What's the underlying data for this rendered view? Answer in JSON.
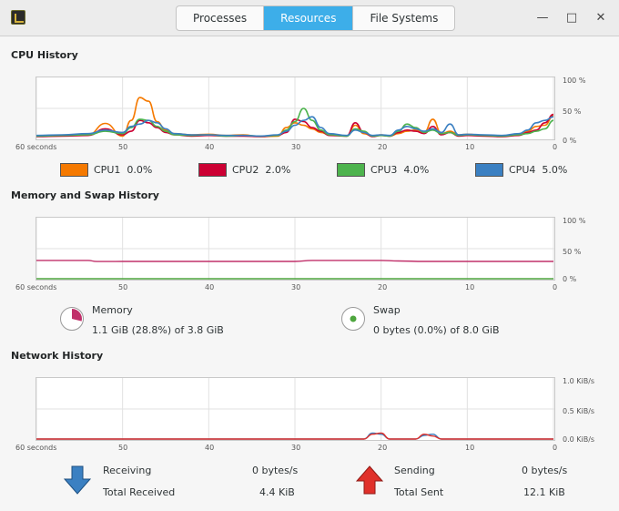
{
  "window": {
    "tabs": [
      {
        "label": "Processes",
        "active": false
      },
      {
        "label": "Resources",
        "active": true
      },
      {
        "label": "File Systems",
        "active": false
      }
    ],
    "controls": {
      "minimize": "—",
      "maximize": "□",
      "close": "✕"
    }
  },
  "colors": {
    "accent": "#3daee9",
    "cpu1": "#f57900",
    "cpu2": "#cc0033",
    "cpu3": "#4db34d",
    "cpu4": "#3b80c2",
    "memory": "#c0306a",
    "swap": "#4ea63e",
    "receiving": "#3b80c2",
    "sending": "#e0302a"
  },
  "axis": {
    "x_labels": [
      "60 seconds",
      "50",
      "40",
      "30",
      "20",
      "10",
      "0"
    ],
    "percent_labels": [
      "100 %",
      "50 %",
      "0 %"
    ],
    "network_labels": [
      "1.0 KiB/s",
      "0.5 KiB/s",
      "0.0 KiB/s"
    ]
  },
  "cpu": {
    "title": "CPU History",
    "legend": [
      {
        "name": "CPU1",
        "value": "0.0%"
      },
      {
        "name": "CPU2",
        "value": "2.0%"
      },
      {
        "name": "CPU3",
        "value": "4.0%"
      },
      {
        "name": "CPU4",
        "value": "5.0%"
      }
    ]
  },
  "memory": {
    "title": "Memory and Swap History",
    "memory_label": "Memory",
    "memory_value": "1.1 GiB (28.8%) of 3.8 GiB",
    "memory_fraction": 0.288,
    "swap_label": "Swap",
    "swap_value": "0 bytes (0.0%) of 8.0 GiB",
    "swap_fraction": 0.0
  },
  "network": {
    "title": "Network History",
    "receiving_label": "Receiving",
    "receiving_value": "0 bytes/s",
    "total_received_label": "Total Received",
    "total_received_value": "4.4 KiB",
    "sending_label": "Sending",
    "sending_value": "0 bytes/s",
    "total_sent_label": "Total Sent",
    "total_sent_value": "12.1 KiB"
  },
  "chart_data": [
    {
      "type": "line",
      "title": "CPU History",
      "xlabel": "",
      "ylabel": "",
      "ylim": [
        0,
        100
      ],
      "x": [
        60,
        57,
        54,
        52,
        50,
        49,
        48,
        47,
        46,
        45,
        44,
        42,
        40,
        38,
        36,
        34,
        32,
        31,
        30,
        29,
        28,
        27,
        26,
        24,
        23,
        22,
        21,
        20,
        19,
        18,
        17,
        16,
        15,
        14,
        13,
        12,
        11,
        10,
        8,
        6,
        4,
        3,
        2,
        1,
        0
      ],
      "series": [
        {
          "name": "CPU1",
          "values": [
            4,
            5,
            6,
            25,
            4,
            30,
            68,
            62,
            28,
            14,
            8,
            6,
            7,
            5,
            6,
            3,
            4,
            18,
            26,
            22,
            16,
            10,
            6,
            4,
            22,
            8,
            4,
            6,
            4,
            8,
            12,
            14,
            10,
            32,
            8,
            12,
            6,
            7,
            5,
            3,
            6,
            12,
            20,
            22,
            38
          ]
        },
        {
          "name": "CPU2",
          "values": [
            3,
            4,
            5,
            16,
            6,
            12,
            30,
            26,
            18,
            10,
            6,
            4,
            5,
            4,
            4,
            3,
            5,
            10,
            32,
            28,
            18,
            12,
            5,
            4,
            26,
            10,
            3,
            5,
            4,
            10,
            14,
            12,
            8,
            20,
            6,
            10,
            4,
            5,
            4,
            3,
            5,
            10,
            14,
            26,
            40
          ]
        },
        {
          "name": "CPU3",
          "values": [
            4,
            5,
            6,
            12,
            8,
            18,
            32,
            30,
            20,
            12,
            6,
            5,
            6,
            4,
            5,
            4,
            5,
            14,
            28,
            50,
            30,
            14,
            6,
            4,
            16,
            12,
            4,
            5,
            4,
            12,
            24,
            18,
            10,
            14,
            8,
            10,
            5,
            6,
            5,
            4,
            6,
            8,
            12,
            16,
            30
          ]
        },
        {
          "name": "CPU4",
          "values": [
            5,
            6,
            8,
            14,
            10,
            20,
            24,
            30,
            26,
            16,
            8,
            6,
            6,
            5,
            5,
            4,
            6,
            12,
            22,
            30,
            36,
            18,
            8,
            5,
            14,
            10,
            5,
            6,
            5,
            14,
            20,
            16,
            12,
            16,
            10,
            24,
            6,
            7,
            6,
            5,
            8,
            14,
            26,
            30,
            36
          ]
        }
      ]
    },
    {
      "type": "line",
      "title": "Memory and Swap History",
      "xlabel": "",
      "ylabel": "",
      "ylim": [
        0,
        100
      ],
      "x": [
        60,
        54,
        53,
        50,
        40,
        30,
        28,
        20,
        18,
        15,
        10,
        0
      ],
      "series": [
        {
          "name": "Memory",
          "values": [
            30.5,
            30.5,
            28.6,
            28.8,
            28.8,
            28.8,
            30.5,
            30.5,
            29.5,
            28.8,
            28.8,
            28.8
          ]
        },
        {
          "name": "Swap",
          "values": [
            0,
            0,
            0,
            0,
            0,
            0,
            0,
            0,
            0,
            0,
            0,
            0
          ]
        }
      ]
    },
    {
      "type": "line",
      "title": "Network History",
      "xlabel": "",
      "ylabel": "",
      "ylim": [
        0,
        1.0
      ],
      "x": [
        60,
        40,
        22,
        21,
        20,
        19,
        16,
        15,
        14,
        13,
        12,
        0
      ],
      "series": [
        {
          "name": "Receiving",
          "values": [
            0,
            0,
            0,
            0.1,
            0.08,
            0,
            0,
            0.06,
            0.08,
            0,
            0,
            0
          ]
        },
        {
          "name": "Sending",
          "values": [
            0,
            0,
            0,
            0.08,
            0.1,
            0,
            0,
            0.08,
            0.05,
            0,
            0,
            0
          ]
        }
      ]
    }
  ]
}
